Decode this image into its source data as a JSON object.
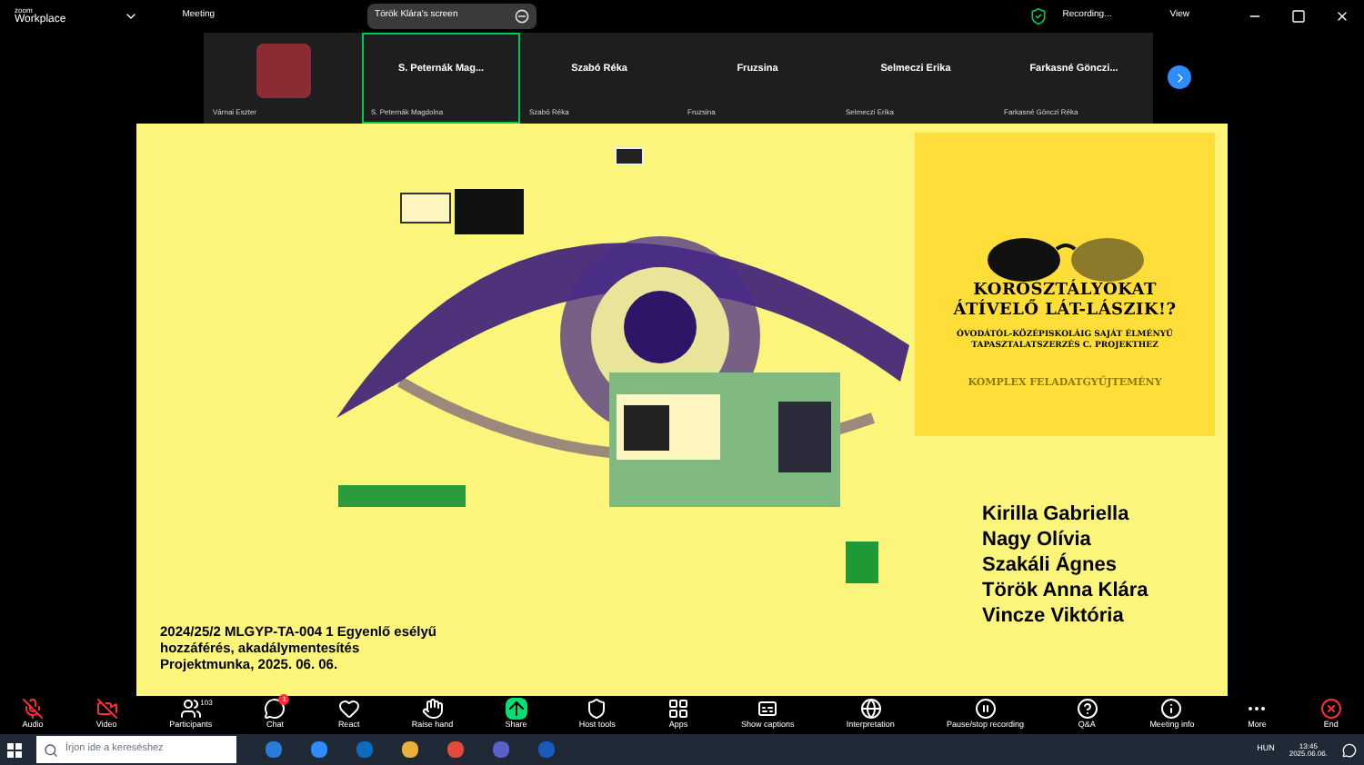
{
  "topbar": {
    "brand_top": "zoom",
    "brand": "Workplace",
    "meeting": "Meeting",
    "share_label": "Török Klára's screen",
    "recording": "Recording...",
    "view": "View"
  },
  "participants": [
    {
      "kind": "photo",
      "footer_name": "Várnai Eszter",
      "selected": false
    },
    {
      "kind": "name",
      "tile_name": "S. Peternák Mag...",
      "footer_name": "S. Peternák Magdolna",
      "selected": true
    },
    {
      "kind": "name",
      "tile_name": "Szabó Réka",
      "footer_name": "Szabó Réka",
      "selected": false
    },
    {
      "kind": "name",
      "tile_name": "Fruzsina",
      "footer_name": "Fruzsina",
      "selected": false
    },
    {
      "kind": "name",
      "tile_name": "Selmeczi Erika",
      "footer_name": "Selmeczi Erika",
      "selected": false
    },
    {
      "kind": "name",
      "tile_name": "Farkasné Gönczi...",
      "footer_name": "Farkasné Gönczi Réka",
      "selected": false
    }
  ],
  "slide": {
    "card": {
      "title": "KOROSZTÁLYOKAT ÁTÍVELŐ LÁT-LÁSZIK!?",
      "subtitle": "ÓVODÁTÓL-KÖZÉPISKOLÁIG SAJÁT ÉLMÉNYŰ TAPASZTALATSZERZÉS C. PROJEKTHEZ",
      "footer": "KOMPLEX FELADATGYŰJTEMÉNY"
    },
    "names": [
      "Kirilla Gabriella",
      "Nagy Olívia",
      "Szakáli Ágnes",
      "Török Anna Klára",
      "Vincze Viktória"
    ],
    "footer_lines": [
      "2024/25/2 MLGYP-TA-004 1 Egyenlő esélyű",
      "hozzáférés, akadálymentesítés",
      "Projektmunka, 2025. 06. 06."
    ]
  },
  "toolbar": [
    {
      "kind": "audio",
      "label": "Audio",
      "muted": true
    },
    {
      "kind": "video",
      "label": "Video",
      "muted": true
    },
    {
      "kind": "participants",
      "label": "Participants",
      "count": "103"
    },
    {
      "kind": "chat",
      "label": "Chat",
      "badge": "1"
    },
    {
      "kind": "react",
      "label": "React"
    },
    {
      "kind": "hand",
      "label": "Raise hand"
    },
    {
      "kind": "share",
      "label": "Share"
    },
    {
      "kind": "host",
      "label": "Host tools"
    },
    {
      "kind": "apps",
      "label": "Apps"
    },
    {
      "kind": "captions",
      "label": "Show captions"
    },
    {
      "kind": "globe",
      "label": "Interpretation"
    },
    {
      "kind": "record",
      "label": "Pause/stop recording"
    },
    {
      "kind": "qa",
      "label": "Q&A"
    },
    {
      "kind": "info",
      "label": "Meeting info"
    },
    {
      "kind": "more",
      "label": "More"
    },
    {
      "kind": "end",
      "label": "End"
    }
  ],
  "taskbar": {
    "search_placeholder": "Írjon ide a kereséshez",
    "language": "HUN",
    "time": "13:45",
    "date": "2025.06.06."
  }
}
